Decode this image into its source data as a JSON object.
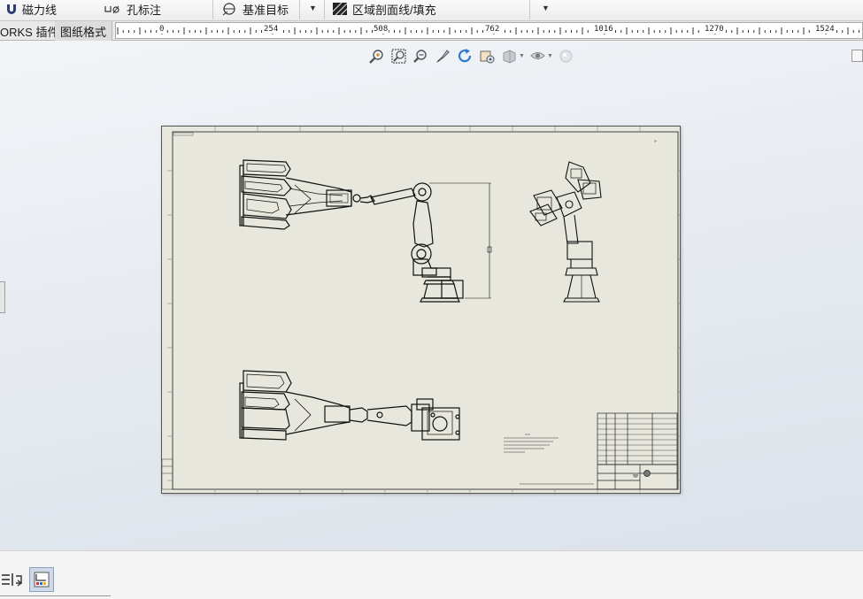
{
  "toolbar": {
    "magnet_line": "磁力线",
    "hole_callout": "孔标注",
    "datum_target": "基准目标",
    "area_hatch": "区域剖面线/填充"
  },
  "tabs": [
    {
      "label": "ORKS 插件",
      "active": false
    },
    {
      "label": "图纸格式",
      "active": true
    }
  ],
  "ruler": {
    "unit_ticks": [
      "0",
      "254",
      "508",
      "762",
      "1016",
      "1270",
      "1524"
    ]
  },
  "view_toolbar": {
    "icons": [
      "zoom-to-fit-icon",
      "zoom-to-area-icon",
      "zoom-in-out-icon",
      "select-tool-icon",
      "rotate-view-icon",
      "view-settings-icon",
      "display-style-icon",
      "hide-show-icon",
      "appearance-icon"
    ]
  },
  "bottom": {
    "icons": [
      "list-icon",
      "rebuild-icon",
      "view-palette-icon"
    ]
  },
  "colors": {
    "sheet_background": "#e7e7dd",
    "canvas_gradient_top": "#f2f4f7",
    "canvas_gradient_bottom": "#dce2ea",
    "drawing_line": "#111111"
  }
}
